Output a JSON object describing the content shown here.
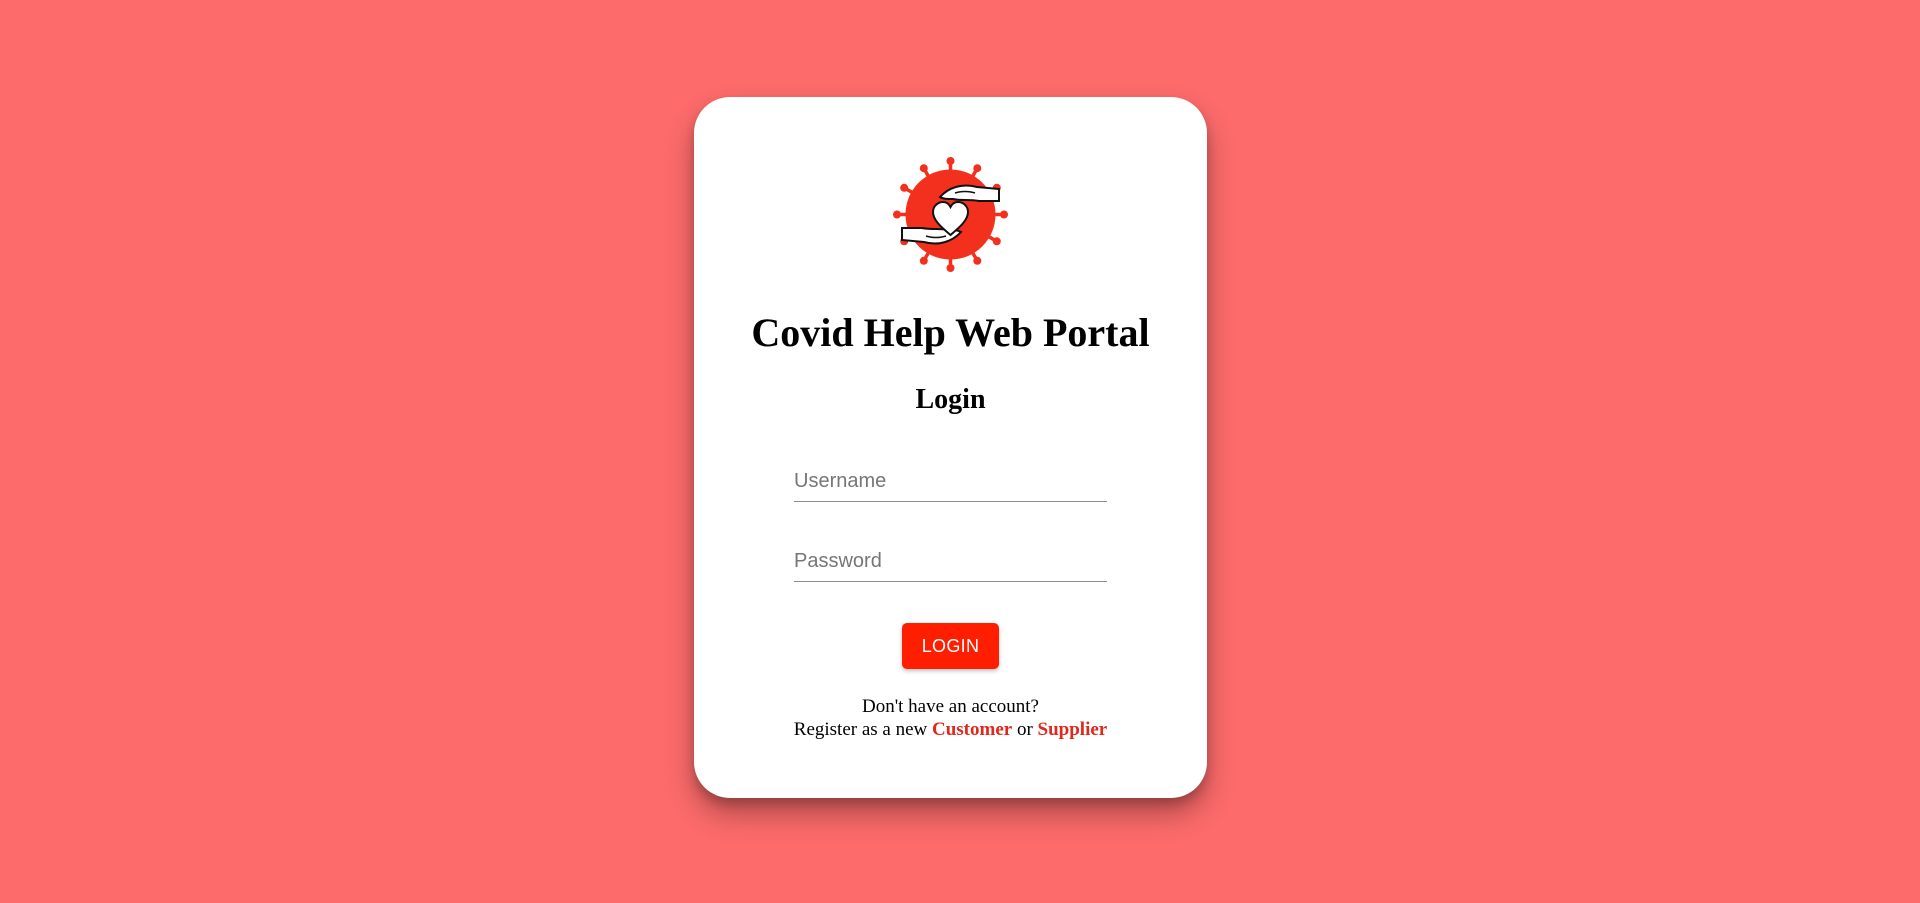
{
  "app": {
    "title": "Covid Help Web Portal",
    "subtitle": "Login",
    "logo_icon": "virus-heart-hands-icon"
  },
  "form": {
    "username": {
      "value": "",
      "placeholder": "Username"
    },
    "password": {
      "value": "",
      "placeholder": "Password"
    },
    "login_label": "LOGIN"
  },
  "footer": {
    "prompt": "Don't have an account?",
    "register_prefix": "Register as a new ",
    "customer_label": "Customer",
    "or_label": " or ",
    "supplier_label": "Supplier"
  },
  "colors": {
    "background": "#fd6b6b",
    "accent": "#ff1f00",
    "link": "#e0281c",
    "card": "#ffffff"
  }
}
